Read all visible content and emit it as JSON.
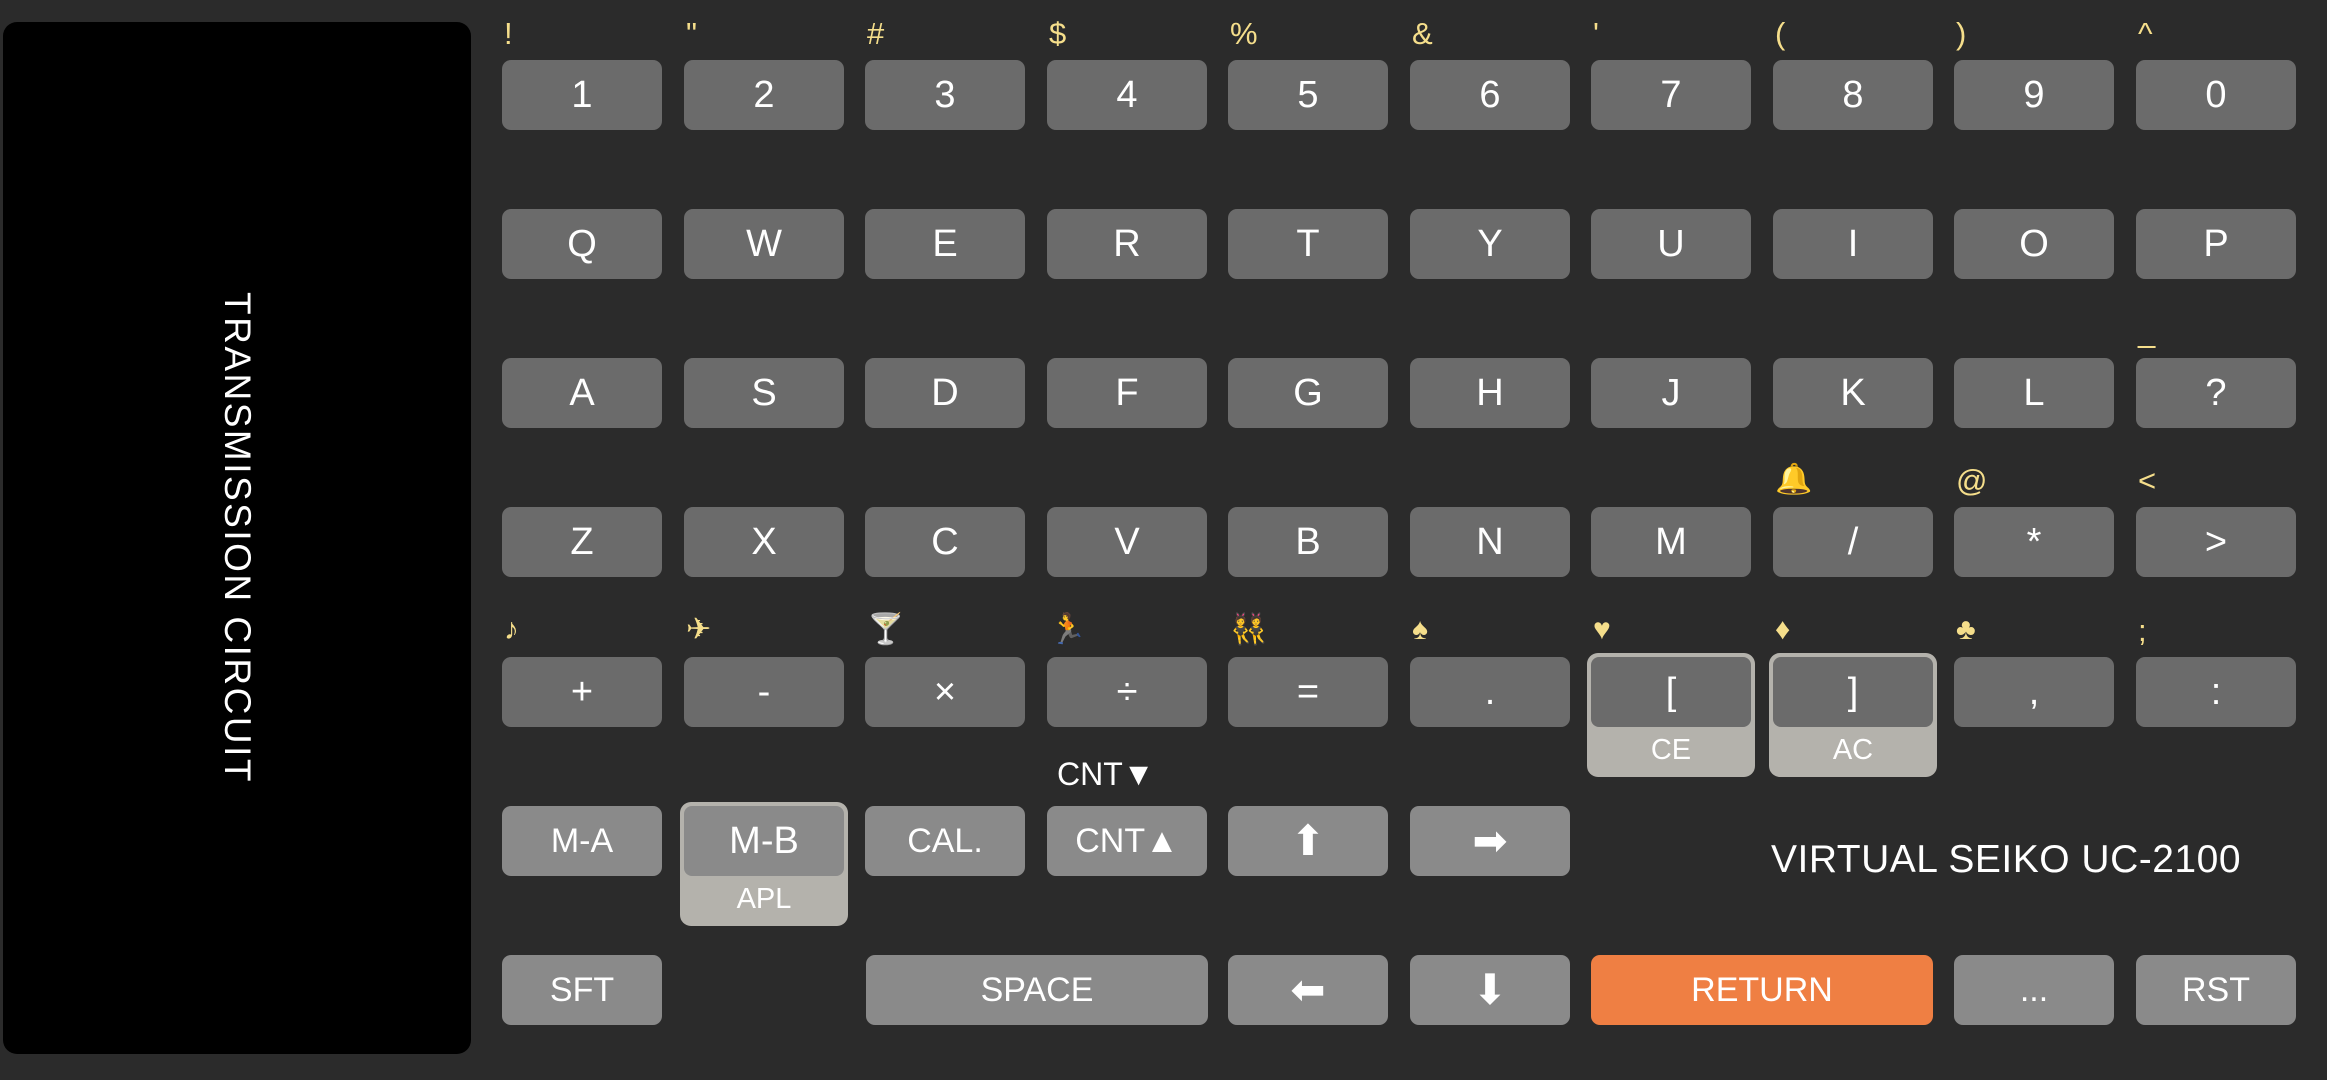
{
  "display": {
    "label": "TRANSMISSION CIRCUIT",
    "background_color": "#000000"
  },
  "brand": {
    "text": "VIRTUAL SEIKO UC-2100"
  },
  "colors": {
    "background": "#2b2b2b",
    "key": "#6b6b6b",
    "key_light": "#8a8a8a",
    "key_accent": "#ef7f43",
    "shift_legend": "#f5de8b",
    "deck_shell": "#b4b2ac",
    "text": "#ffffff"
  },
  "rows": {
    "row1": {
      "name": "number-row",
      "keys": [
        {
          "label": "1",
          "shift": "!"
        },
        {
          "label": "2",
          "shift": "\""
        },
        {
          "label": "3",
          "shift": "#"
        },
        {
          "label": "4",
          "shift": "$"
        },
        {
          "label": "5",
          "shift": "%"
        },
        {
          "label": "6",
          "shift": "&"
        },
        {
          "label": "7",
          "shift": "'"
        },
        {
          "label": "8",
          "shift": "("
        },
        {
          "label": "9",
          "shift": ")"
        },
        {
          "label": "0",
          "shift": "^"
        }
      ]
    },
    "row2": {
      "name": "qwerty-row",
      "keys": [
        {
          "label": "Q",
          "shift": ""
        },
        {
          "label": "W",
          "shift": ""
        },
        {
          "label": "E",
          "shift": ""
        },
        {
          "label": "R",
          "shift": ""
        },
        {
          "label": "T",
          "shift": ""
        },
        {
          "label": "Y",
          "shift": ""
        },
        {
          "label": "U",
          "shift": ""
        },
        {
          "label": "I",
          "shift": ""
        },
        {
          "label": "O",
          "shift": ""
        },
        {
          "label": "P",
          "shift": ""
        }
      ]
    },
    "row3": {
      "name": "home-row",
      "keys": [
        {
          "label": "A",
          "shift": ""
        },
        {
          "label": "S",
          "shift": ""
        },
        {
          "label": "D",
          "shift": ""
        },
        {
          "label": "F",
          "shift": ""
        },
        {
          "label": "G",
          "shift": ""
        },
        {
          "label": "H",
          "shift": ""
        },
        {
          "label": "J",
          "shift": ""
        },
        {
          "label": "K",
          "shift": ""
        },
        {
          "label": "L",
          "shift": ""
        },
        {
          "label": "?",
          "shift": "_"
        }
      ]
    },
    "row4": {
      "name": "bottom-alpha-row",
      "keys": [
        {
          "label": "Z",
          "shift": ""
        },
        {
          "label": "X",
          "shift": ""
        },
        {
          "label": "C",
          "shift": ""
        },
        {
          "label": "V",
          "shift": ""
        },
        {
          "label": "B",
          "shift": ""
        },
        {
          "label": "N",
          "shift": ""
        },
        {
          "label": "M",
          "shift": ""
        },
        {
          "label": "/",
          "shift": "🔔",
          "shift_icon": "bell-icon"
        },
        {
          "label": "*",
          "shift": "@"
        },
        {
          "label": ">",
          "shift": "<"
        }
      ]
    },
    "row5": {
      "name": "operator-row",
      "keys": [
        {
          "label": "+",
          "shift": "♪",
          "shift_icon": "music-note-icon"
        },
        {
          "label": "-",
          "shift": "✈",
          "shift_icon": "airplane-icon"
        },
        {
          "label": "×",
          "shift": "🍸",
          "shift_icon": "cocktail-icon"
        },
        {
          "label": "÷",
          "shift": "🏃",
          "shift_icon": "runner-icon"
        },
        {
          "label": "=",
          "shift": "👯",
          "shift_icon": "dancers-icon"
        },
        {
          "label": ".",
          "shift": "♠",
          "shift_icon": "spade-icon"
        },
        {
          "label": "[",
          "shift": "♥",
          "shift_icon": "heart-icon",
          "caption": "CE",
          "deck": true
        },
        {
          "label": "]",
          "shift": "♦",
          "shift_icon": "diamond-icon",
          "caption": "AC",
          "deck": true
        },
        {
          "label": ",",
          "shift": "♣",
          "shift_icon": "club-icon"
        },
        {
          "label": ":",
          "shift": ";"
        }
      ]
    },
    "row6": {
      "name": "function-row",
      "keys": [
        {
          "label": "M-A"
        },
        {
          "label": "M-B",
          "caption": "APL",
          "deck": true
        },
        {
          "label": "CAL."
        },
        {
          "label": "CNT▲",
          "top_legend": "CNT▼"
        },
        {
          "label": "⬆",
          "icon": "arrow-up-icon"
        },
        {
          "label": "➡",
          "icon": "arrow-right-icon"
        }
      ]
    },
    "row7": {
      "name": "modifier-row",
      "keys": [
        {
          "label": "SFT"
        },
        {
          "label": "SPACE"
        },
        {
          "label": "⬅",
          "icon": "arrow-left-icon"
        },
        {
          "label": "⬇",
          "icon": "arrow-down-icon"
        },
        {
          "label": "RETURN",
          "accent": true
        },
        {
          "label": "..."
        },
        {
          "label": "RST"
        }
      ]
    }
  }
}
